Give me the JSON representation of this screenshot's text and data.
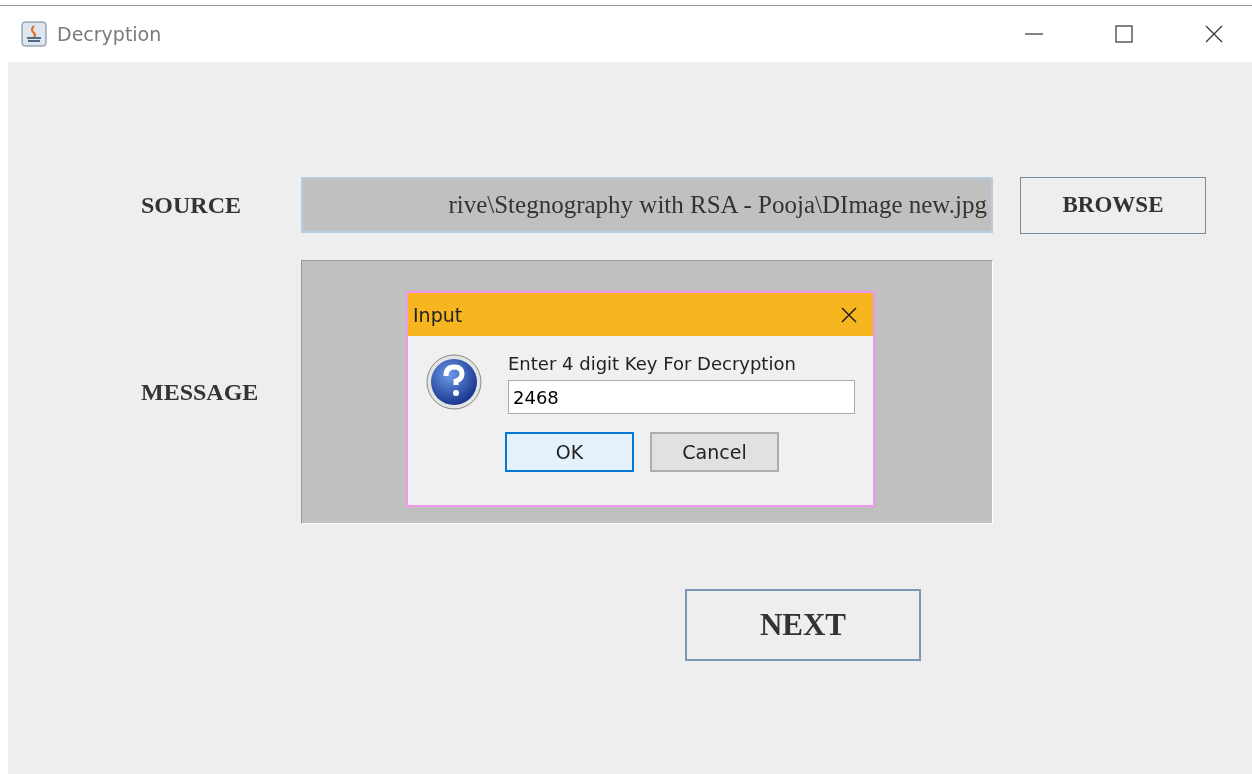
{
  "window": {
    "title": "Decryption"
  },
  "source": {
    "label": "SOURCE",
    "value": "rive\\Stegnography with RSA - Pooja\\DImage new.jpg",
    "button": "BROWSE"
  },
  "message": {
    "label": "MESSAGE"
  },
  "next_button": "NEXT",
  "dialog": {
    "title": "Input",
    "prompt": "Enter 4 digit Key For Decryption",
    "value": "2468",
    "buttons": [
      {
        "label": "OK",
        "focused": true
      },
      {
        "label": "Cancel",
        "focused": false
      }
    ]
  }
}
